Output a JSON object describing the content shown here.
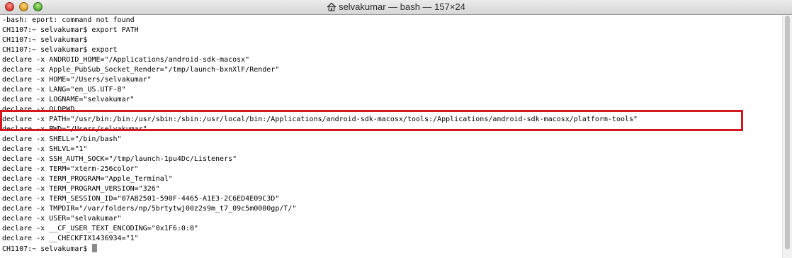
{
  "window": {
    "title": "selvakumar — bash — 157×24"
  },
  "terminal": {
    "lines": [
      "-bash: eport: command not found",
      "CH1107:~ selvakumar$ export PATH",
      "CH1107:~ selvakumar$",
      "CH1107:~ selvakumar$ export",
      "declare -x ANDROID_HOME=\"/Applications/android-sdk-macosx\"",
      "declare -x Apple_PubSub_Socket_Render=\"/tmp/launch-bxnXlF/Render\"",
      "declare -x HOME=\"/Users/selvakumar\"",
      "declare -x LANG=\"en_US.UTF-8\"",
      "declare -x LOGNAME=\"selvakumar\"",
      "declare -x OLDPWD",
      "declare -x PATH=\"/usr/bin:/bin:/usr/sbin:/sbin:/usr/local/bin:/Applications/android-sdk-macosx/tools:/Applications/android-sdk-macosx/platform-tools\"",
      "declare -x PWD=\"/Users/selvakumar\"",
      "declare -x SHELL=\"/bin/bash\"",
      "declare -x SHLVL=\"1\"",
      "declare -x SSH_AUTH_SOCK=\"/tmp/launch-1pu4Dc/Listeners\"",
      "declare -x TERM=\"xterm-256color\"",
      "declare -x TERM_PROGRAM=\"Apple_Terminal\"",
      "declare -x TERM_PROGRAM_VERSION=\"326\"",
      "declare -x TERM_SESSION_ID=\"07AB2501-590F-4465-A1E3-2C6ED4E09C3D\"",
      "declare -x TMPDIR=\"/var/folders/np/5brtytwj00z2s9m_t7_09c5m0000gp/T/\"",
      "declare -x USER=\"selvakumar\"",
      "declare -x __CF_USER_TEXT_ENCODING=\"0x1F6:0:0\"",
      "declare -x __CHECKFIX1436934=\"1\""
    ],
    "prompt": "CH1107:~ selvakumar$ "
  },
  "colors": {
    "highlight": "#d3181f",
    "cursor": "#8a8a8a"
  },
  "icons": {
    "title": "home-icon"
  }
}
